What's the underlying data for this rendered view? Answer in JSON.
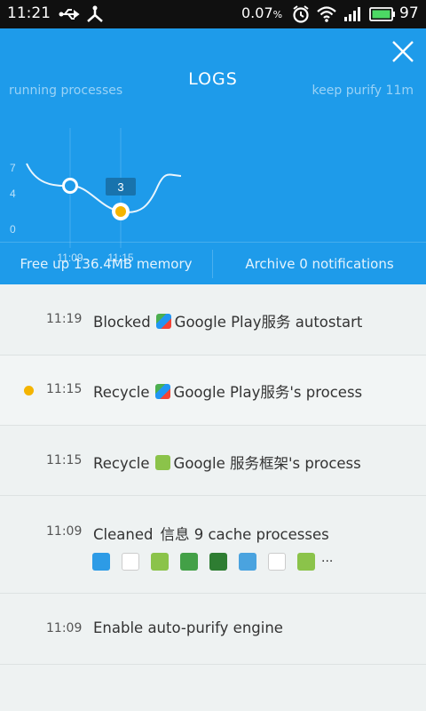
{
  "status_bar": {
    "time": "11:21",
    "data_rate": "0.07",
    "data_unit": "%",
    "battery": "97"
  },
  "header": {
    "title": "LOGS",
    "left_label": "running processes",
    "right_label": "keep purify 11m"
  },
  "chart_data": {
    "type": "line",
    "y_ticks": [
      "7",
      "4",
      "0"
    ],
    "x_ticks": [
      "11:09",
      "11:15"
    ],
    "highlight_x": "11:15",
    "highlight_value": "3",
    "points": [
      {
        "x": "11:09",
        "y": 4.6
      },
      {
        "x": "11:15",
        "y": 3
      }
    ]
  },
  "actions": {
    "free_memory": "Free up 136.4MB memory",
    "archive": "Archive 0 notifications"
  },
  "logs": [
    {
      "time": "11:19",
      "verb": "Blocked",
      "rest": "Google Play服务 autostart",
      "dot": false
    },
    {
      "time": "11:15",
      "verb": "Recycle",
      "rest": "Google Play服务's process",
      "dot": true
    },
    {
      "time": "11:15",
      "verb": "Recycle",
      "rest": "Google 服务框架's process",
      "dot": false
    },
    {
      "time": "11:09",
      "verb": "Cleaned",
      "rest": "信息 9 cache processes",
      "dot": false
    },
    {
      "time": "11:09",
      "verb": "Enable auto-purify engine",
      "rest": "",
      "dot": false
    }
  ],
  "more_indicator": "...",
  "colors": {
    "header": "#1e9bea",
    "accent_dot": "#f4b400",
    "status_bar": "#101010"
  }
}
